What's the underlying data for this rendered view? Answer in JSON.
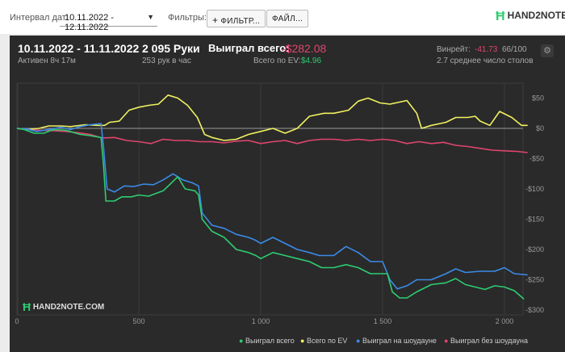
{
  "topbar": {
    "interval_label": "Интервал дат:",
    "date_range": "10.11.2022 - 12.11.2022",
    "filters_label": "Фильтры:",
    "filters_button": "ФИЛЬТР...",
    "file_button": "ФАЙЛ...",
    "logo": "HAND2NOTE"
  },
  "header": {
    "dates": "10.11.2022 - 11.11.2022",
    "active": "Активен 8ч 17м",
    "hands": "2 095 Руки",
    "hands_rate": "253 рук в час",
    "won_label": "Выиграл всего:",
    "won_value": "-$282.08",
    "ev_label": "Всего по EV:",
    "ev_value": "$4.96",
    "winrate_label": "Винрейт:",
    "winrate_value": "-41.73",
    "winrate_sample": "66/100",
    "tables": "2.7 среднее число столов"
  },
  "watermark": "HAND2NOTE.COM",
  "colors": {
    "won": "#2ecc71",
    "ev": "#f0f060",
    "showdown": "#3b8be8",
    "nonshowdown": "#e0456e",
    "negative": "#e0456e",
    "positive": "#2ecc71"
  },
  "chart_data": {
    "type": "line",
    "xlim": [
      0,
      2095
    ],
    "ylim": [
      -300,
      70
    ],
    "x_ticks": [
      0,
      500,
      1000,
      1500,
      2000
    ],
    "x_tick_labels": [
      "0",
      "500",
      "1 000",
      "1 500",
      "2 000"
    ],
    "y_ticks": [
      50,
      0,
      -50,
      -100,
      -150,
      -200,
      -250,
      -300
    ],
    "y_tick_labels": [
      "$50",
      "$0",
      "-$50",
      "-$100",
      "-$150",
      "-$200",
      "-$250",
      "-$300"
    ],
    "series": [
      {
        "name": "Выиграл всего",
        "color": "#2ecc71",
        "points": [
          [
            0,
            0
          ],
          [
            30,
            -2
          ],
          [
            70,
            -8
          ],
          [
            110,
            -8
          ],
          [
            150,
            -2
          ],
          [
            200,
            -3
          ],
          [
            260,
            -10
          ],
          [
            300,
            -12
          ],
          [
            345,
            -15
          ],
          [
            355,
            -60
          ],
          [
            365,
            -120
          ],
          [
            400,
            -120
          ],
          [
            430,
            -113
          ],
          [
            470,
            -113
          ],
          [
            500,
            -110
          ],
          [
            540,
            -112
          ],
          [
            600,
            -103
          ],
          [
            660,
            -80
          ],
          [
            690,
            -100
          ],
          [
            730,
            -103
          ],
          [
            745,
            -110
          ],
          [
            760,
            -150
          ],
          [
            800,
            -170
          ],
          [
            850,
            -180
          ],
          [
            900,
            -200
          ],
          [
            950,
            -205
          ],
          [
            980,
            -210
          ],
          [
            1000,
            -215
          ],
          [
            1050,
            -205
          ],
          [
            1100,
            -210
          ],
          [
            1150,
            -215
          ],
          [
            1200,
            -220
          ],
          [
            1250,
            -230
          ],
          [
            1300,
            -230
          ],
          [
            1350,
            -225
          ],
          [
            1400,
            -230
          ],
          [
            1450,
            -240
          ],
          [
            1520,
            -240
          ],
          [
            1540,
            -270
          ],
          [
            1570,
            -280
          ],
          [
            1600,
            -280
          ],
          [
            1640,
            -270
          ],
          [
            1700,
            -258
          ],
          [
            1760,
            -255
          ],
          [
            1800,
            -248
          ],
          [
            1840,
            -258
          ],
          [
            1880,
            -262
          ],
          [
            1920,
            -266
          ],
          [
            1960,
            -260
          ],
          [
            2000,
            -262
          ],
          [
            2040,
            -268
          ],
          [
            2080,
            -282
          ]
        ]
      },
      {
        "name": "Всего по EV",
        "color": "#f0f060",
        "points": [
          [
            0,
            0
          ],
          [
            40,
            -2
          ],
          [
            90,
            0
          ],
          [
            130,
            4
          ],
          [
            180,
            4
          ],
          [
            220,
            3
          ],
          [
            280,
            6
          ],
          [
            330,
            5
          ],
          [
            360,
            5
          ],
          [
            380,
            10
          ],
          [
            420,
            12
          ],
          [
            460,
            30
          ],
          [
            500,
            35
          ],
          [
            540,
            38
          ],
          [
            580,
            40
          ],
          [
            620,
            55
          ],
          [
            660,
            50
          ],
          [
            700,
            38
          ],
          [
            740,
            18
          ],
          [
            770,
            -10
          ],
          [
            800,
            -15
          ],
          [
            850,
            -20
          ],
          [
            900,
            -18
          ],
          [
            950,
            -10
          ],
          [
            1000,
            -5
          ],
          [
            1050,
            0
          ],
          [
            1100,
            -8
          ],
          [
            1150,
            0
          ],
          [
            1200,
            20
          ],
          [
            1260,
            25
          ],
          [
            1300,
            25
          ],
          [
            1360,
            30
          ],
          [
            1400,
            45
          ],
          [
            1440,
            50
          ],
          [
            1490,
            42
          ],
          [
            1530,
            40
          ],
          [
            1600,
            46
          ],
          [
            1640,
            25
          ],
          [
            1660,
            0
          ],
          [
            1700,
            5
          ],
          [
            1760,
            10
          ],
          [
            1800,
            18
          ],
          [
            1850,
            18
          ],
          [
            1880,
            20
          ],
          [
            1900,
            12
          ],
          [
            1940,
            5
          ],
          [
            1980,
            28
          ],
          [
            2030,
            18
          ],
          [
            2070,
            5
          ],
          [
            2095,
            5
          ]
        ]
      },
      {
        "name": "Выиграл на шоудауне",
        "color": "#3b8be8",
        "points": [
          [
            0,
            0
          ],
          [
            40,
            -1
          ],
          [
            80,
            -5
          ],
          [
            130,
            -2
          ],
          [
            180,
            2
          ],
          [
            220,
            -2
          ],
          [
            260,
            3
          ],
          [
            300,
            6
          ],
          [
            345,
            8
          ],
          [
            355,
            -30
          ],
          [
            370,
            -100
          ],
          [
            400,
            -105
          ],
          [
            440,
            -95
          ],
          [
            480,
            -96
          ],
          [
            520,
            -92
          ],
          [
            560,
            -93
          ],
          [
            600,
            -85
          ],
          [
            640,
            -75
          ],
          [
            680,
            -85
          ],
          [
            720,
            -90
          ],
          [
            745,
            -95
          ],
          [
            760,
            -140
          ],
          [
            800,
            -160
          ],
          [
            850,
            -165
          ],
          [
            900,
            -175
          ],
          [
            950,
            -180
          ],
          [
            980,
            -185
          ],
          [
            1000,
            -190
          ],
          [
            1050,
            -180
          ],
          [
            1100,
            -190
          ],
          [
            1150,
            -200
          ],
          [
            1200,
            -205
          ],
          [
            1240,
            -210
          ],
          [
            1300,
            -210
          ],
          [
            1350,
            -195
          ],
          [
            1400,
            -205
          ],
          [
            1450,
            -220
          ],
          [
            1500,
            -220
          ],
          [
            1530,
            -250
          ],
          [
            1560,
            -265
          ],
          [
            1600,
            -260
          ],
          [
            1640,
            -250
          ],
          [
            1700,
            -250
          ],
          [
            1760,
            -240
          ],
          [
            1800,
            -232
          ],
          [
            1840,
            -238
          ],
          [
            1900,
            -236
          ],
          [
            1960,
            -236
          ],
          [
            2000,
            -230
          ],
          [
            2040,
            -240
          ],
          [
            2095,
            -242
          ]
        ]
      },
      {
        "name": "Выиграл без шоудауна",
        "color": "#e0456e",
        "points": [
          [
            0,
            0
          ],
          [
            50,
            -2
          ],
          [
            100,
            -3
          ],
          [
            150,
            -4
          ],
          [
            200,
            -5
          ],
          [
            250,
            -7
          ],
          [
            300,
            -10
          ],
          [
            350,
            -16
          ],
          [
            400,
            -15
          ],
          [
            450,
            -20
          ],
          [
            500,
            -22
          ],
          [
            550,
            -25
          ],
          [
            600,
            -18
          ],
          [
            650,
            -20
          ],
          [
            700,
            -20
          ],
          [
            750,
            -22
          ],
          [
            800,
            -22
          ],
          [
            850,
            -24
          ],
          [
            900,
            -21
          ],
          [
            950,
            -20
          ],
          [
            1000,
            -25
          ],
          [
            1050,
            -22
          ],
          [
            1100,
            -20
          ],
          [
            1150,
            -25
          ],
          [
            1200,
            -20
          ],
          [
            1250,
            -18
          ],
          [
            1300,
            -18
          ],
          [
            1350,
            -20
          ],
          [
            1400,
            -18
          ],
          [
            1450,
            -20
          ],
          [
            1500,
            -18
          ],
          [
            1550,
            -20
          ],
          [
            1600,
            -25
          ],
          [
            1650,
            -22
          ],
          [
            1700,
            -25
          ],
          [
            1750,
            -23
          ],
          [
            1800,
            -28
          ],
          [
            1850,
            -30
          ],
          [
            1900,
            -33
          ],
          [
            1950,
            -36
          ],
          [
            2000,
            -37
          ],
          [
            2050,
            -38
          ],
          [
            2095,
            -40
          ]
        ]
      }
    ]
  }
}
